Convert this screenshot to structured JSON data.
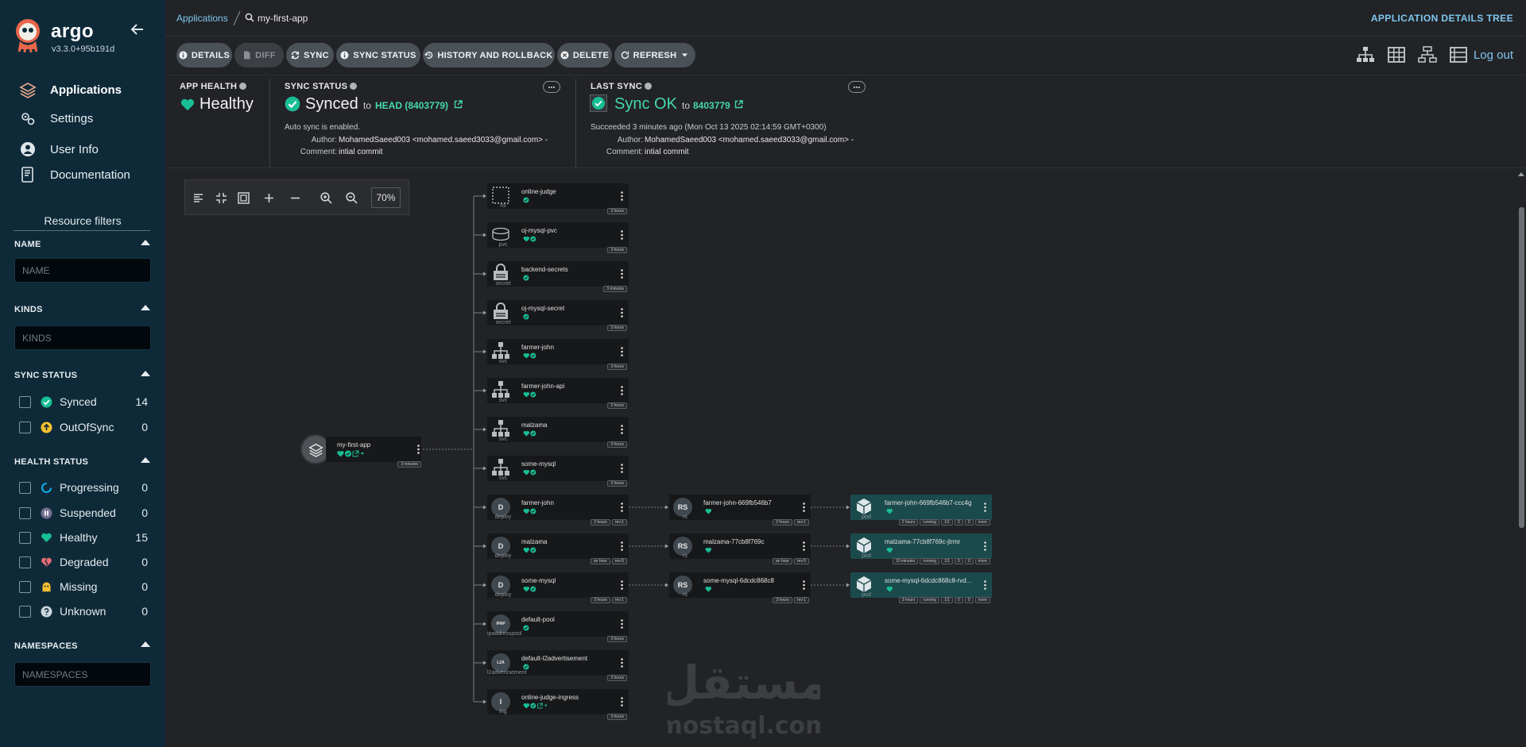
{
  "sidebar": {
    "brand": "argo",
    "version": "v3.3.0+95b191d",
    "nav": [
      {
        "label": "Applications",
        "icon": "layers-icon",
        "active": true
      },
      {
        "label": "Settings",
        "icon": "gears-icon"
      },
      {
        "label": "User Info",
        "icon": "user-circle-icon"
      },
      {
        "label": "Documentation",
        "icon": "book-icon"
      }
    ],
    "resource_filters_title": "Resource filters",
    "name_section": {
      "title": "NAME",
      "placeholder": "NAME"
    },
    "kinds_section": {
      "title": "KINDS",
      "placeholder": "KINDS"
    },
    "sync_status": {
      "title": "SYNC STATUS",
      "items": [
        {
          "label": "Synced",
          "count": "14",
          "icon": "check-circle-icon",
          "color": "#18be94"
        },
        {
          "label": "OutOfSync",
          "count": "0",
          "icon": "arrow-up-circle-icon",
          "color": "#f4c030"
        }
      ]
    },
    "health_status": {
      "title": "HEALTH STATUS",
      "items": [
        {
          "label": "Progressing",
          "count": "0",
          "icon": "progress-ring-icon",
          "color": "#0dadea"
        },
        {
          "label": "Suspended",
          "count": "0",
          "icon": "pause-circle-icon",
          "color": "#766f94"
        },
        {
          "label": "Healthy",
          "count": "15",
          "icon": "heart-icon",
          "color": "#18be94"
        },
        {
          "label": "Degraded",
          "count": "0",
          "icon": "broken-heart-icon",
          "color": "#e96d76"
        },
        {
          "label": "Missing",
          "count": "0",
          "icon": "ghost-icon",
          "color": "#f4c030"
        },
        {
          "label": "Unknown",
          "count": "0",
          "icon": "question-circle-icon",
          "color": "#ccd6dd"
        }
      ]
    },
    "namespaces_section": {
      "title": "NAMESPACES",
      "placeholder": "NAMESPACES"
    }
  },
  "topbar": {
    "breadcrumb_root": "Applications",
    "breadcrumb_current": "my-first-app",
    "page_title": "APPLICATION DETAILS TREE",
    "logout": "Log out"
  },
  "toolbar": {
    "buttons": [
      "DETAILS",
      "DIFF",
      "SYNC",
      "SYNC STATUS",
      "HISTORY AND ROLLBACK",
      "DELETE",
      "REFRESH"
    ]
  },
  "status": {
    "app_health": {
      "title": "APP HEALTH",
      "value": "Healthy"
    },
    "sync_status": {
      "title": "SYNC STATUS",
      "value": "Synced",
      "to": "to",
      "revision": "HEAD (8403779)",
      "auto_sync": "Auto sync is enabled.",
      "author_label": "Author:",
      "author": "MohamedSaeed003 <mohamed.saeed3033@gmail.com> -",
      "comment_label": "Comment:",
      "comment": "intial commit"
    },
    "last_sync": {
      "title": "LAST SYNC",
      "value": "Sync OK",
      "to": "to",
      "revision": "8403779",
      "succeeded": "Succeeded 3 minutes ago (Mon Oct 13 2025 02:14:59 GMT+0300)",
      "author_label": "Author:",
      "author": "MohamedSaeed003 <mohamed.saeed3033@gmail.com> -",
      "comment_label": "Comment:",
      "comment": "intial commit"
    }
  },
  "graph": {
    "zoom": "70%",
    "root": {
      "name": "my-first-app",
      "age": "3 minutes"
    },
    "resources": [
      {
        "name": "online-judge",
        "kind": "ns",
        "age": "3 hours"
      },
      {
        "name": "oj-mysql-pvc",
        "kind": "pvc",
        "age": "3 hours"
      },
      {
        "name": "backend-secrets",
        "kind": "secret",
        "age": "3 minutes"
      },
      {
        "name": "oj-mysql-secret",
        "kind": "secret",
        "age": "3 hours"
      },
      {
        "name": "farmer-john",
        "kind": "svc",
        "age": "3 hours"
      },
      {
        "name": "farmer-john-api",
        "kind": "svc",
        "age": "2 hours"
      },
      {
        "name": "malzama",
        "kind": "svc",
        "age": "3 hours"
      },
      {
        "name": "some-mysql",
        "kind": "svc",
        "age": "3 hours"
      },
      {
        "name": "farmer-john",
        "kind": "deploy",
        "age": "2 hours",
        "rev": "rev:1"
      },
      {
        "name": "malzama",
        "kind": "deploy",
        "age": "an hour",
        "rev": "rev:5"
      },
      {
        "name": "some-mysql",
        "kind": "deploy",
        "age": "3 hours",
        "rev": "rev:1"
      },
      {
        "name": "default-pool",
        "kind": "ipaddresspool",
        "age": "3 hours"
      },
      {
        "name": "default-l2advertisement",
        "kind": "l2advertisement",
        "age": "3 hours"
      },
      {
        "name": "online-judge-ingress",
        "kind": "ing",
        "age": "3 hours"
      }
    ],
    "replicasets": [
      {
        "name": "farmer-john-669fb546b7",
        "kind": "rs",
        "age": "2 hours",
        "rev": "rev:1"
      },
      {
        "name": "malzama-77cb8f769c",
        "kind": "rs",
        "age": "an hour",
        "rev": "rev:5"
      },
      {
        "name": "some-mysql-6dcdc868c8",
        "kind": "rs",
        "age": "3 hours",
        "rev": "rev:1"
      }
    ],
    "pods": [
      {
        "name": "farmer-john-669fb546b7-ccc4g",
        "kind": "pod",
        "age": "2 hours",
        "state": "running",
        "ready": "1/1",
        "restarts": "0",
        "b": "0",
        "more": "more"
      },
      {
        "name": "malzama-77cb8f769c-jtrmr",
        "kind": "pod",
        "age": "10 minutes",
        "state": "running",
        "ready": "1/1",
        "restarts": "0",
        "b": "0",
        "more": "more"
      },
      {
        "name": "some-mysql-6dcdc868c8-rvd...",
        "kind": "pod",
        "age": "3 hours",
        "state": "running",
        "ready": "1/1",
        "restarts": "0",
        "b": "0",
        "more": "more"
      }
    ],
    "circle_labels": {
      "deploy": "D",
      "rs": "RS",
      "ipaddresspool": "IPAP",
      "l2advertisement": "L2A",
      "ing": "I"
    }
  },
  "watermark": {
    "arabic": "مستقل",
    "latin": "mostaql.com"
  },
  "colors": {
    "accent": "#7ec7f0",
    "healthy": "#18be94",
    "sidebar": "#0e2a39",
    "page": "#222326"
  }
}
